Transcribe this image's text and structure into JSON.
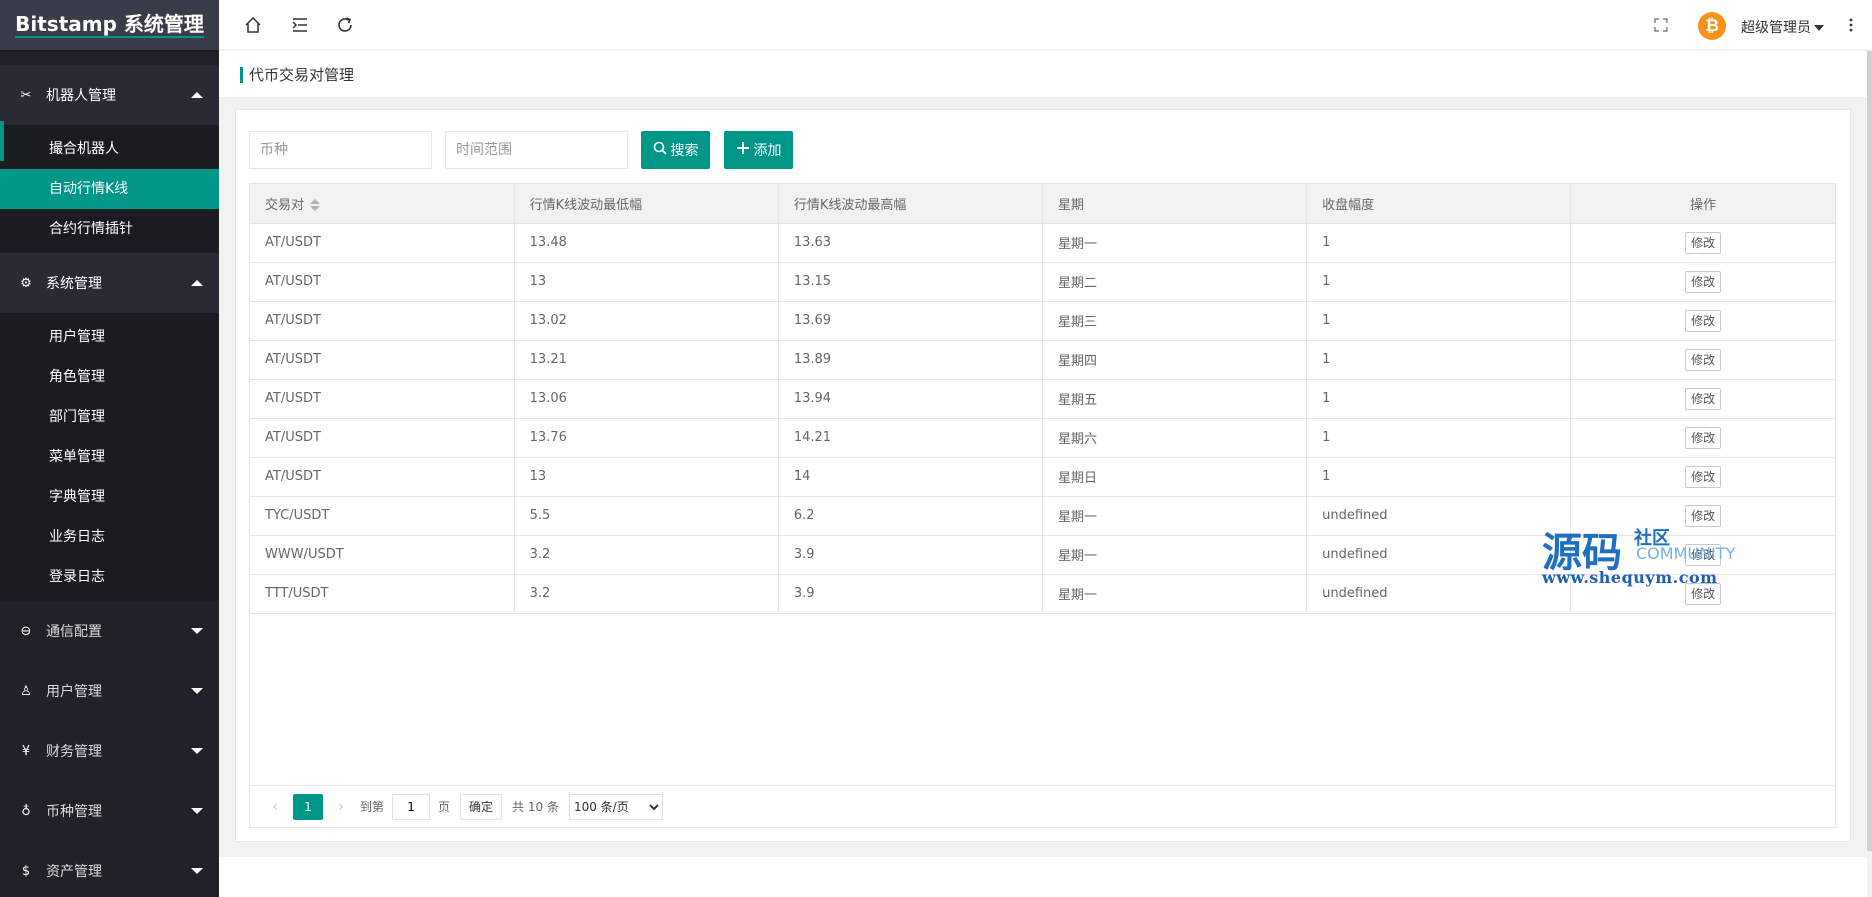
{
  "app": {
    "title": "Bitstamp 系统管理"
  },
  "sidebar": {
    "groups": [
      {
        "label": "机器人管理",
        "icon": "wrench-icon",
        "items": [
          {
            "label": "撮合机器人"
          },
          {
            "label": "自动行情K线"
          },
          {
            "label": "合约行情插针"
          }
        ]
      },
      {
        "label": "系统管理",
        "icon": "gear-icon",
        "items": [
          {
            "label": "用户管理"
          },
          {
            "label": "角色管理"
          },
          {
            "label": "部门管理"
          },
          {
            "label": "菜单管理"
          },
          {
            "label": "字典管理"
          },
          {
            "label": "业务日志"
          },
          {
            "label": "登录日志"
          }
        ]
      },
      {
        "label": "通信配置",
        "icon": "chat-icon"
      },
      {
        "label": "用户管理",
        "icon": "user-icon"
      },
      {
        "label": "财务管理",
        "icon": "yen-icon"
      },
      {
        "label": "币种管理",
        "icon": "coins-icon"
      },
      {
        "label": "资产管理",
        "icon": "dollar-icon"
      }
    ]
  },
  "header": {
    "username": "超级管理员",
    "avatar_symbol": "₿"
  },
  "page": {
    "title": "代币交易对管理"
  },
  "search": {
    "coin_placeholder": "币种",
    "time_placeholder": "时间范围",
    "search_label": "搜索",
    "add_label": "添加"
  },
  "table": {
    "headers": [
      "交易对",
      "行情K线波动最低幅",
      "行情K线波动最高幅",
      "星期",
      "收盘幅度",
      "操作"
    ],
    "edit_label": "修改",
    "rows": [
      [
        "AT/USDT",
        "13.48",
        "13.63",
        "星期一",
        "1"
      ],
      [
        "AT/USDT",
        "13",
        "13.15",
        "星期二",
        "1"
      ],
      [
        "AT/USDT",
        "13.02",
        "13.69",
        "星期三",
        "1"
      ],
      [
        "AT/USDT",
        "13.21",
        "13.89",
        "星期四",
        "1"
      ],
      [
        "AT/USDT",
        "13.06",
        "13.94",
        "星期五",
        "1"
      ],
      [
        "AT/USDT",
        "13.76",
        "14.21",
        "星期六",
        "1"
      ],
      [
        "AT/USDT",
        "13",
        "14",
        "星期日",
        "1"
      ],
      [
        "TYC/USDT",
        "5.5",
        "6.2",
        "星期一",
        "undefined"
      ],
      [
        "WWW/USDT",
        "3.2",
        "3.9",
        "星期一",
        "undefined"
      ],
      [
        "TTT/USDT",
        "3.2",
        "3.9",
        "星期一",
        "undefined"
      ]
    ]
  },
  "pager": {
    "current": "1",
    "goto_label": "到第",
    "goto_value": "1",
    "page_unit": "页",
    "confirm_label": "确定",
    "total_label": "共 10 条",
    "page_size": "100 条/页"
  },
  "watermark": {
    "main": "源码",
    "side": "社区",
    "community": "COMMUNITY",
    "url": "www.shequym.com"
  }
}
